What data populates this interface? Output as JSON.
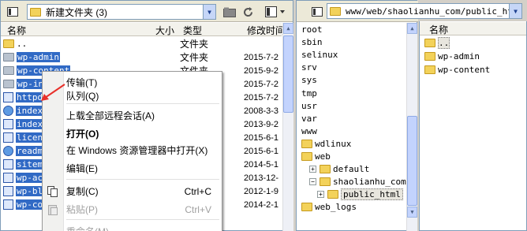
{
  "left_pane": {
    "path": "新建文件夹 (3)",
    "headers": {
      "name": "名称",
      "size": "大小",
      "type": "类型",
      "modified": "修改时间"
    },
    "rows": [
      {
        "name": "..",
        "type": "文件夹",
        "modified": "",
        "icon": "folder"
      },
      {
        "name": "wp-admin",
        "type": "文件夹",
        "modified": "2015-7-2",
        "icon": "folder"
      },
      {
        "name": "wp-content",
        "type": "文件夹",
        "modified": "2015-9-2",
        "icon": "folder"
      },
      {
        "name": "wp-inc",
        "type": "",
        "modified": "2015-7-2",
        "icon": "folder"
      },
      {
        "name": "httpd.",
        "type": "",
        "modified": "2015-7-2",
        "icon": "file"
      },
      {
        "name": "index.",
        "type": "",
        "modified": "2008-3-3",
        "icon": "ie"
      },
      {
        "name": "index.",
        "type": "",
        "modified": "2013-9-2",
        "icon": "file"
      },
      {
        "name": "licens",
        "type": "",
        "modified": "2015-6-1",
        "icon": "file"
      },
      {
        "name": "readme",
        "type": "",
        "modified": "2015-6-1",
        "icon": "ie"
      },
      {
        "name": "sitema",
        "type": "",
        "modified": "2014-5-1",
        "icon": "file"
      },
      {
        "name": "wp-act",
        "type": "",
        "modified": "2013-12-",
        "icon": "file"
      },
      {
        "name": "wp-blo",
        "type": "",
        "modified": "2012-1-9",
        "icon": "file"
      },
      {
        "name": "wp-com",
        "type": "",
        "modified": "2014-2-1",
        "icon": "file"
      }
    ]
  },
  "context_menu": {
    "items": [
      {
        "label": "传输(T)",
        "shortcut": "",
        "style": "normal"
      },
      {
        "label": "队列(Q)",
        "shortcut": "",
        "style": "normal"
      },
      {
        "label": "上载全部远程会话(A)",
        "shortcut": "",
        "style": "normal"
      },
      {
        "label": "打开(O)",
        "shortcut": "",
        "style": "bold"
      },
      {
        "label": "在 Windows 资源管理器中打开(X)",
        "shortcut": "",
        "style": "normal"
      },
      {
        "label": "编辑(E)",
        "shortcut": "",
        "style": "normal"
      },
      {
        "label": "复制(C)",
        "shortcut": "Ctrl+C",
        "style": "normal"
      },
      {
        "label": "粘贴(P)",
        "shortcut": "Ctrl+V",
        "style": "disabled"
      },
      {
        "label": "重命名(M)",
        "shortcut": "",
        "style": "disabled"
      }
    ]
  },
  "tree_pane": {
    "path": "www/web/shaolianhu_com/public_html",
    "items": [
      {
        "label": "root",
        "indent": 0,
        "kind": "text"
      },
      {
        "label": "sbin",
        "indent": 0,
        "kind": "text"
      },
      {
        "label": "selinux",
        "indent": 0,
        "kind": "text"
      },
      {
        "label": "srv",
        "indent": 0,
        "kind": "text"
      },
      {
        "label": "sys",
        "indent": 0,
        "kind": "text"
      },
      {
        "label": "tmp",
        "indent": 0,
        "kind": "text"
      },
      {
        "label": "usr",
        "indent": 0,
        "kind": "text"
      },
      {
        "label": "var",
        "indent": 0,
        "kind": "text"
      },
      {
        "label": "www",
        "indent": 0,
        "kind": "text"
      },
      {
        "label": "wdlinux",
        "indent": 0,
        "kind": "folder"
      },
      {
        "label": "web",
        "indent": 0,
        "kind": "folder"
      },
      {
        "label": "default",
        "indent": 1,
        "kind": "folder-plus"
      },
      {
        "label": "shaolianhu_com",
        "indent": 1,
        "kind": "folder-minus"
      },
      {
        "label": "public_html",
        "indent": 2,
        "kind": "folder-plus-selected"
      },
      {
        "label": "web_logs",
        "indent": 0,
        "kind": "folder"
      }
    ]
  },
  "right_pane": {
    "header_name": "名称",
    "rows": [
      {
        "name": ".."
      },
      {
        "name": "wp-admin"
      },
      {
        "name": "wp-content"
      }
    ]
  },
  "colors": {
    "selection": "#316ac5",
    "accent": "#e8302a"
  }
}
